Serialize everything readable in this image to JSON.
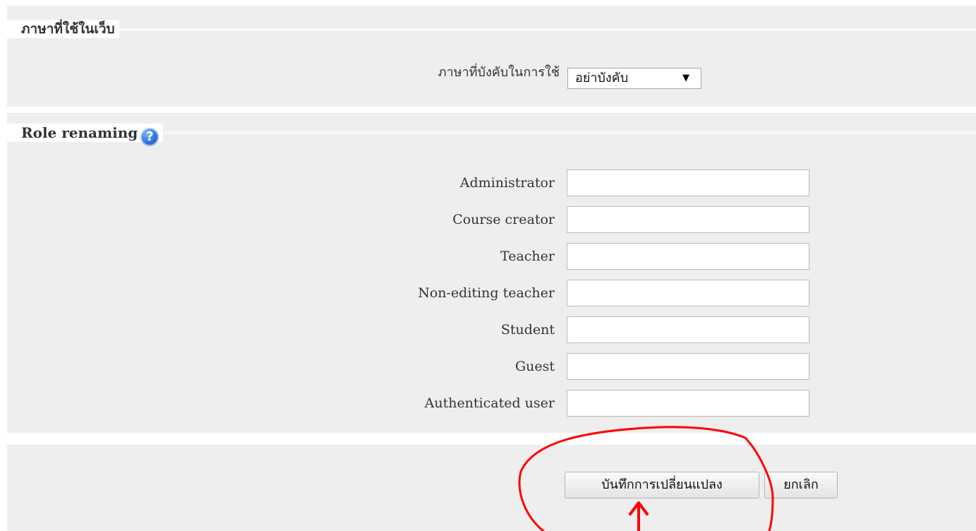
{
  "language_section": {
    "legend": "ภาษาที่ใช้ในเว็บ",
    "force_language_label": "ภาษาที่บังคับในการใช้",
    "force_language_value": "อย่าบังคับ"
  },
  "role_section": {
    "legend": "Role renaming",
    "help_icon": "help-icon",
    "roles": [
      {
        "label": "Administrator",
        "value": ""
      },
      {
        "label": "Course creator",
        "value": ""
      },
      {
        "label": "Teacher",
        "value": ""
      },
      {
        "label": "Non-editing teacher",
        "value": ""
      },
      {
        "label": "Student",
        "value": ""
      },
      {
        "label": "Guest",
        "value": ""
      },
      {
        "label": "Authenticated user",
        "value": ""
      }
    ]
  },
  "actions": {
    "save_label": "บันทึกการเปลี่ยนแปลง",
    "cancel_label": "ยกเลิก"
  },
  "annotation": {
    "color": "#ff0000"
  }
}
